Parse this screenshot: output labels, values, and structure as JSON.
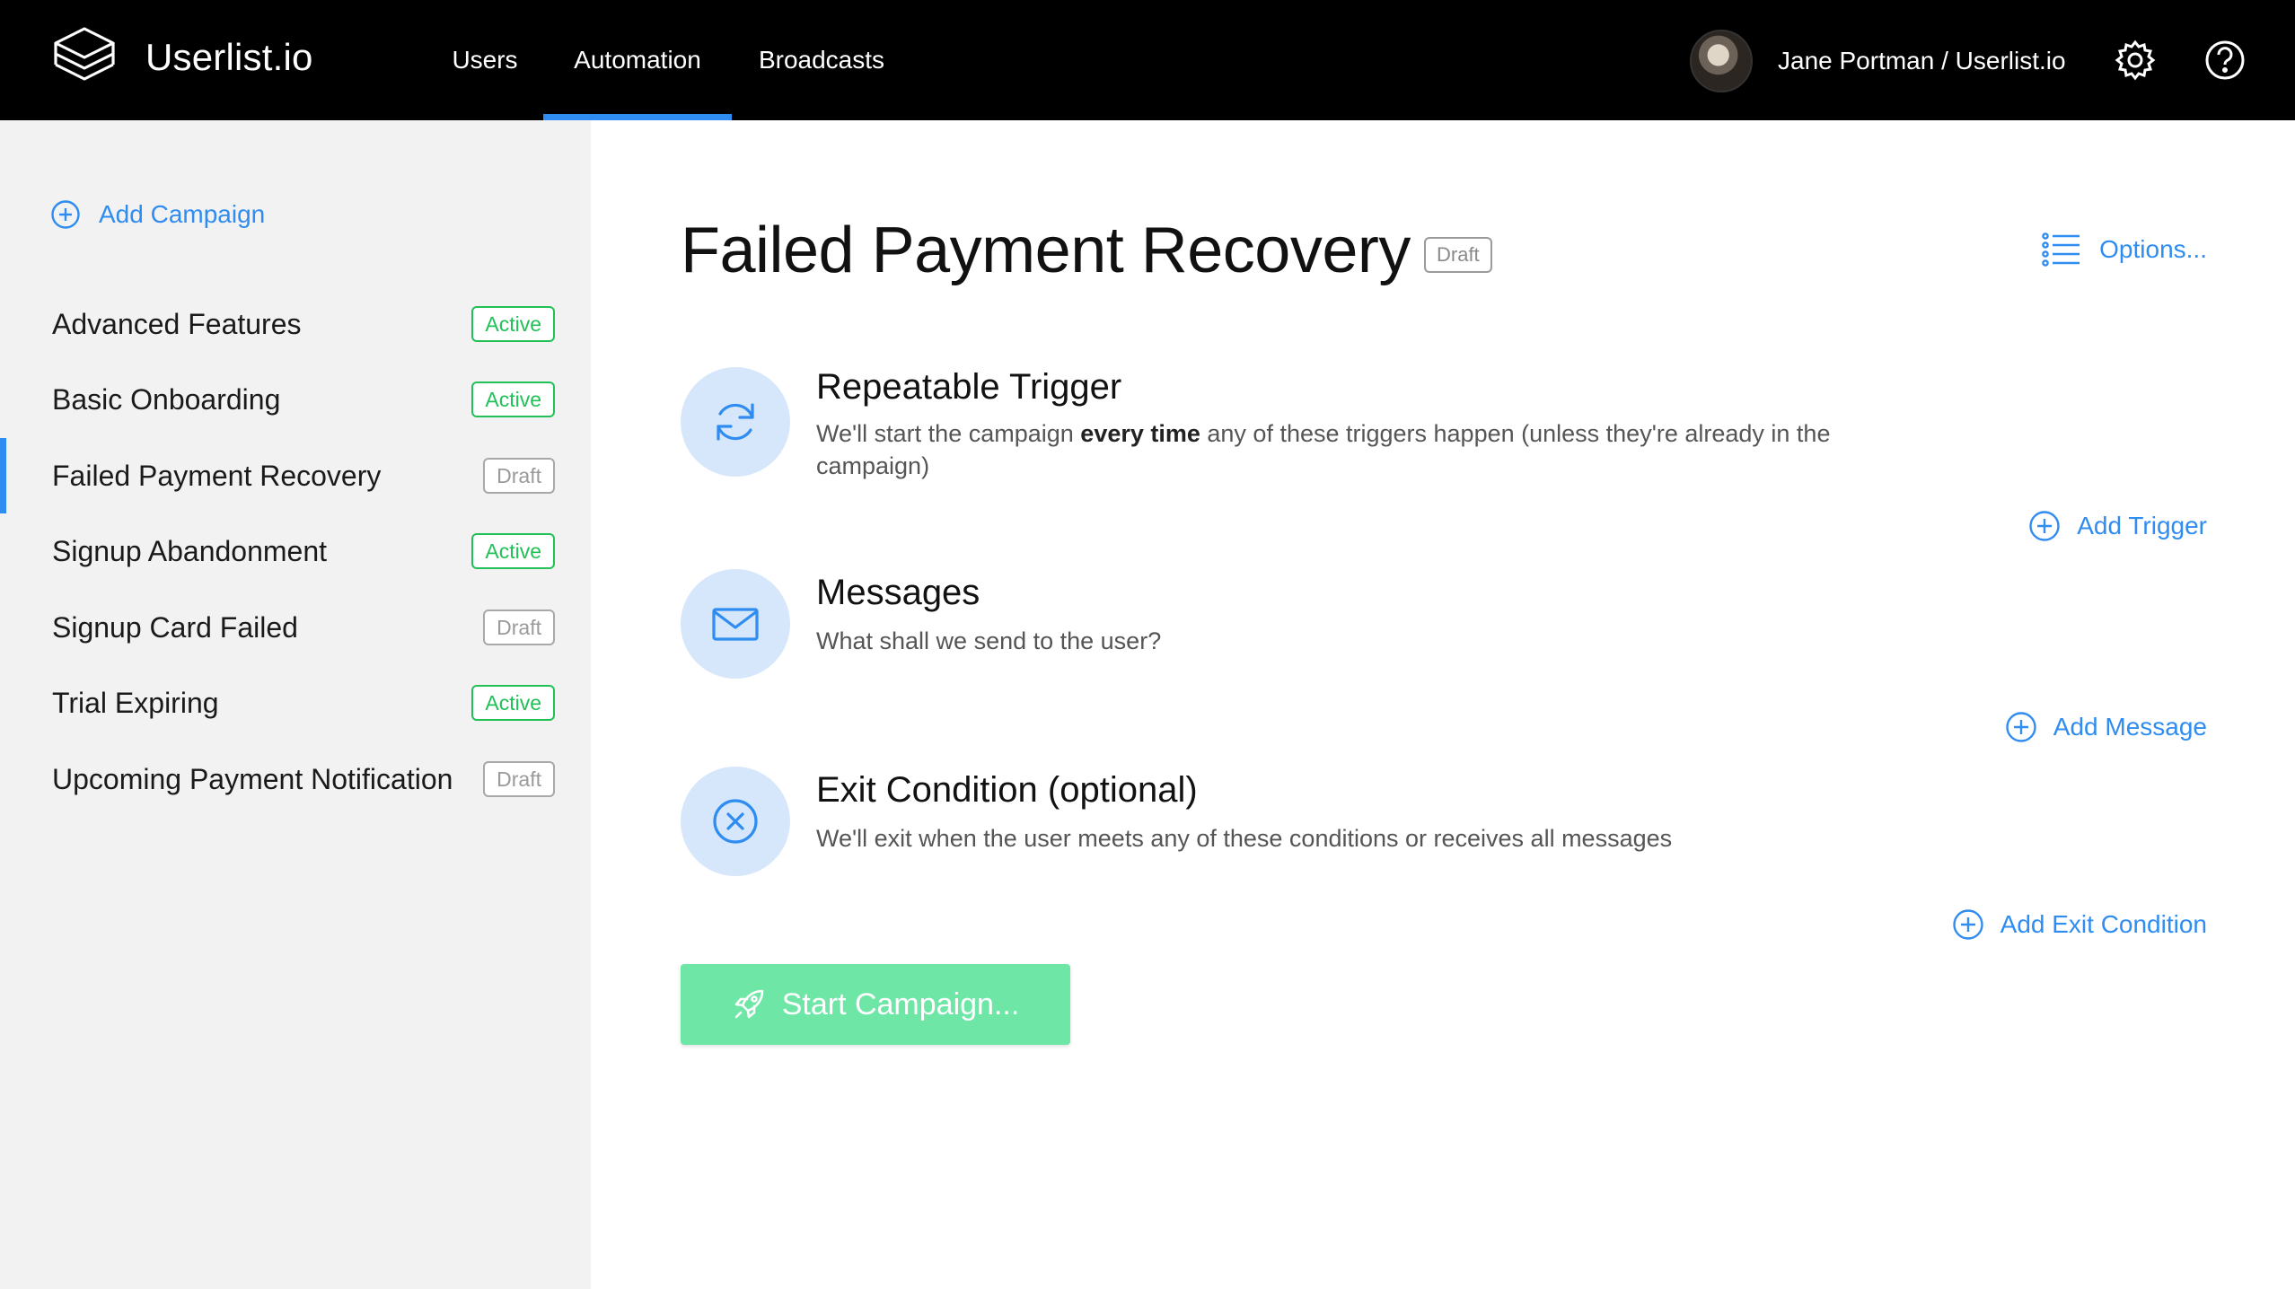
{
  "app": {
    "name": "Userlist.io"
  },
  "nav": {
    "items": [
      "Users",
      "Automation",
      "Broadcasts"
    ],
    "active": "Automation"
  },
  "user": {
    "name": "Jane Portman / Userlist.io"
  },
  "sidebar": {
    "add_label": "Add Campaign",
    "campaigns": [
      {
        "name": "Advanced Features",
        "status": "Active"
      },
      {
        "name": "Basic Onboarding",
        "status": "Active"
      },
      {
        "name": "Failed Payment Recovery",
        "status": "Draft",
        "selected": true
      },
      {
        "name": "Signup Abandonment",
        "status": "Active"
      },
      {
        "name": "Signup Card Failed",
        "status": "Draft"
      },
      {
        "name": "Trial Expiring",
        "status": "Active"
      },
      {
        "name": "Upcoming Payment Notification",
        "status": "Draft"
      }
    ]
  },
  "main": {
    "title": "Failed Payment Recovery",
    "status": "Draft",
    "options_label": "Options...",
    "trigger": {
      "title": "Repeatable Trigger",
      "desc_before": "We'll start the campaign ",
      "desc_bold": "every time",
      "desc_after": " any of these triggers happen (unless they're already in the campaign)",
      "action": "Add Trigger"
    },
    "messages": {
      "title": "Messages",
      "desc": "What shall we send to the user?",
      "action": "Add Message"
    },
    "exit": {
      "title": "Exit Condition (optional)",
      "desc": "We'll exit when the user meets any of these conditions or receives all messages",
      "action": "Add Exit Condition"
    },
    "start_label": "Start Campaign..."
  },
  "colors": {
    "accent": "#2f8cf0",
    "active": "#21c157",
    "start_button": "#6de6a6",
    "icon_circle": "#d6e7fb"
  },
  "icons": [
    "layers-logo-icon",
    "gear-icon",
    "help-icon",
    "plus-circle-icon",
    "list-icon",
    "refresh-icon",
    "envelope-icon",
    "x-circle-icon",
    "rocket-icon"
  ]
}
